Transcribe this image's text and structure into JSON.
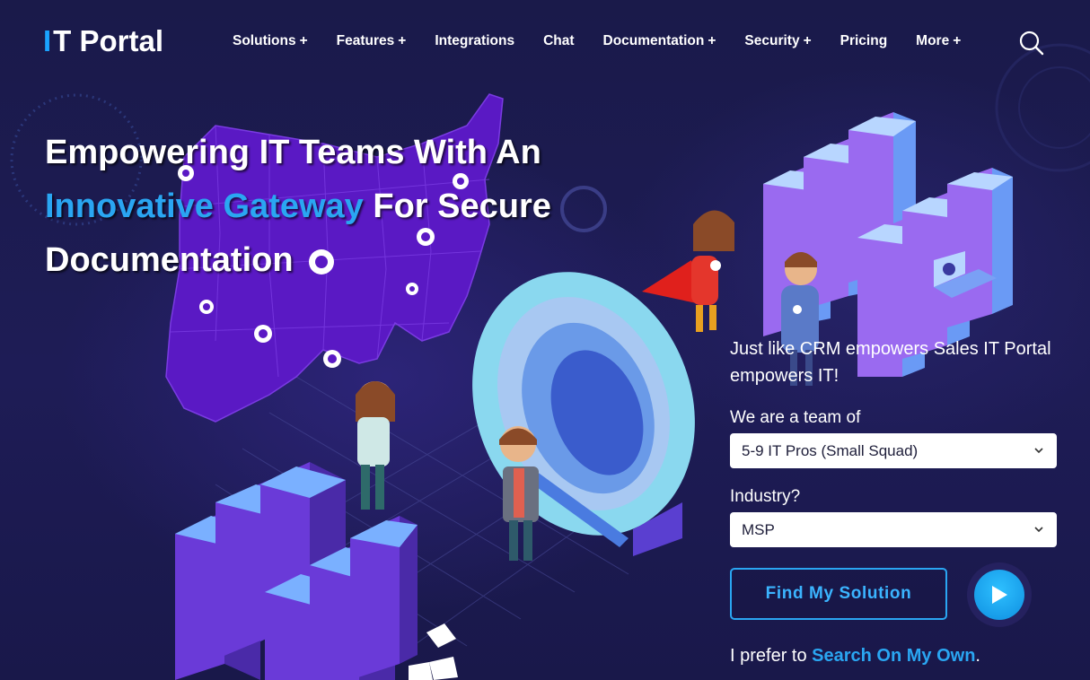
{
  "brand": {
    "logo_mark": "I",
    "logo_text": "T Portal"
  },
  "nav": {
    "items": [
      {
        "label": "Solutions",
        "expandable": true
      },
      {
        "label": "Features",
        "expandable": true
      },
      {
        "label": "Integrations",
        "expandable": false
      },
      {
        "label": "Chat",
        "expandable": false
      },
      {
        "label": "Documentation",
        "expandable": true
      },
      {
        "label": "Security",
        "expandable": true
      },
      {
        "label": "Pricing",
        "expandable": false
      },
      {
        "label": "More",
        "expandable": true
      }
    ],
    "plus_symbol": "+",
    "search_icon": "search-icon"
  },
  "hero": {
    "line1": "Empowering IT Teams With An",
    "line2_accent": "Innovative Gateway",
    "line2_rest": " For Secure",
    "line3": "Documentation"
  },
  "panel": {
    "tagline": "Just like CRM empowers Sales IT Portal empowers IT!",
    "team_label": "We are a team of",
    "team_value": "5-9 IT Pros (Small Squad)",
    "industry_label": "Industry?",
    "industry_value": "MSP",
    "cta_label": "Find My Solution",
    "play_icon": "play-icon",
    "prefer_text": "I prefer to ",
    "prefer_link": "Search On My Own",
    "prefer_end": "."
  },
  "colors": {
    "background": "#1b1b4e",
    "accent": "#2aa6f2",
    "map_purple": "#6a1fd0",
    "server_blue": "#5a8ef0",
    "server_violet": "#8a4ee8",
    "portal_cyan": "#8fe0f5"
  }
}
